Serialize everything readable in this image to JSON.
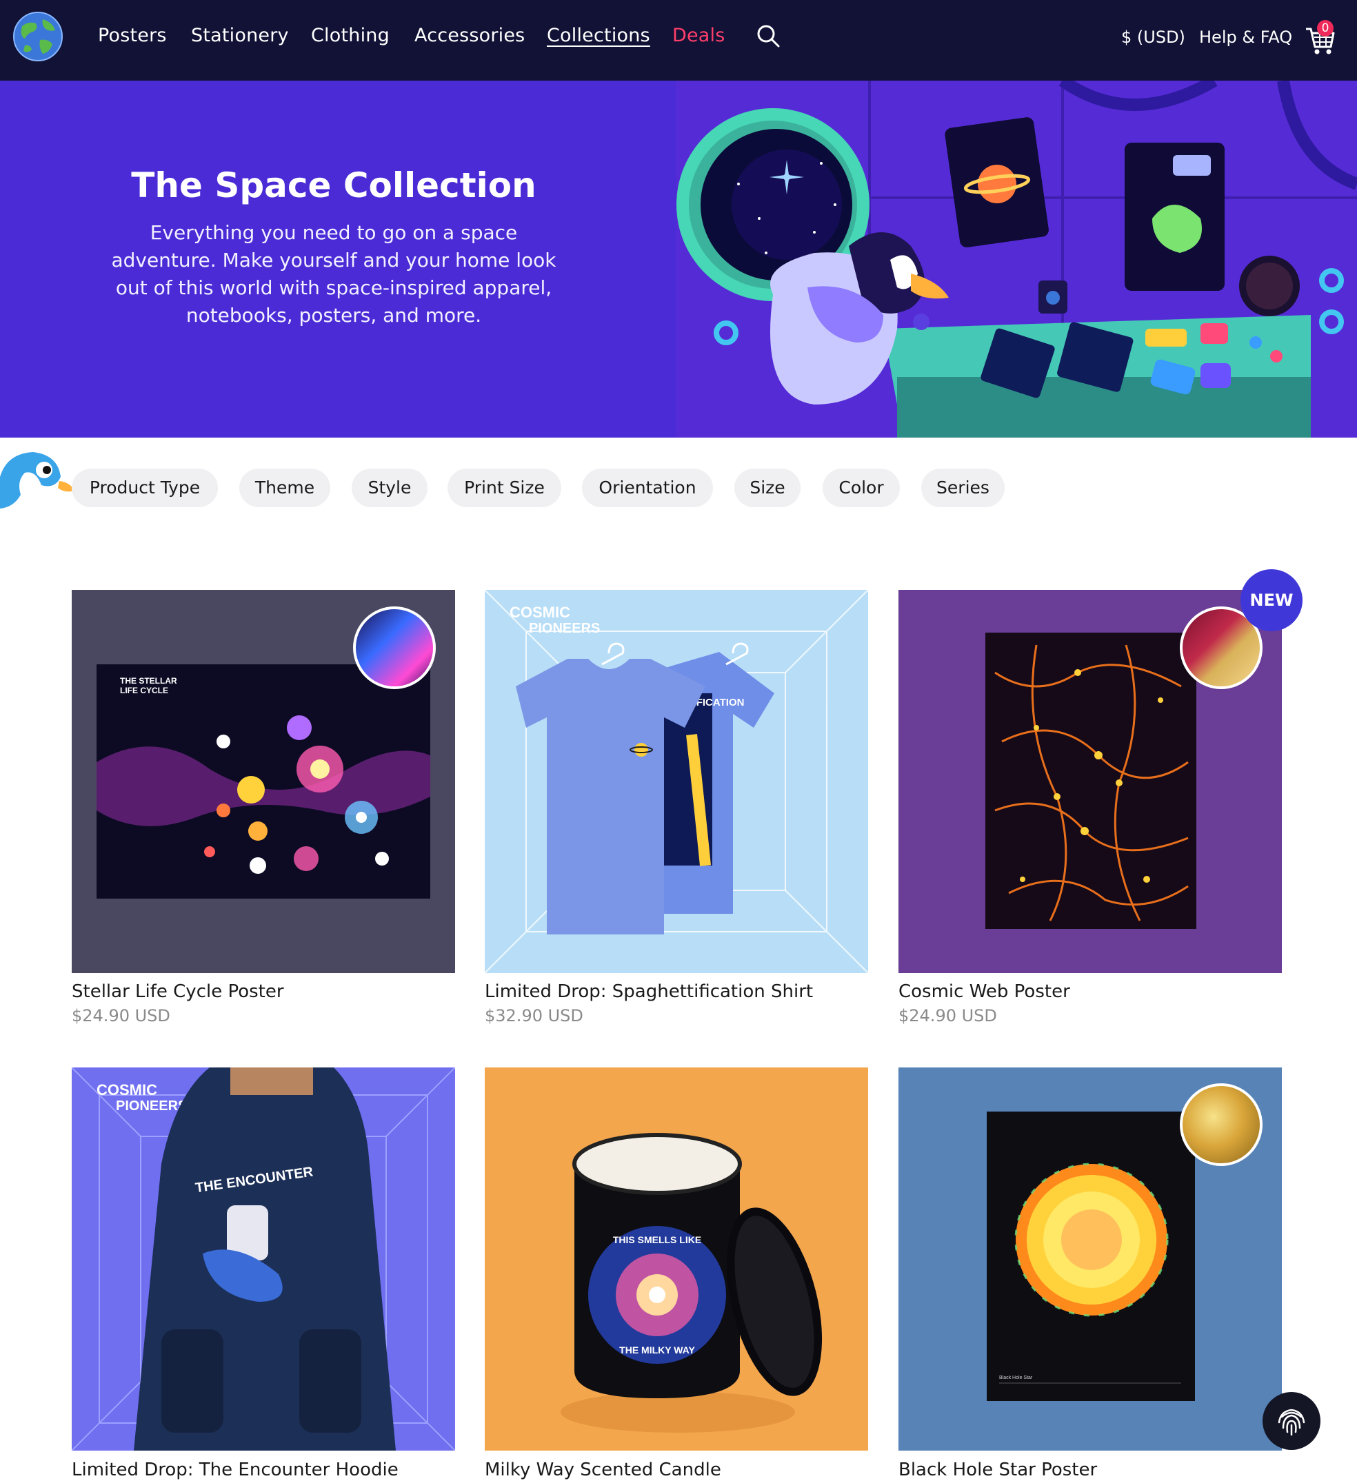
{
  "nav": {
    "links": [
      "Posters",
      "Stationery",
      "Clothing",
      "Accessories",
      "Collections",
      "Deals"
    ],
    "currency": "$ (USD)",
    "help": "Help & FAQ",
    "cart_count": "0"
  },
  "hero": {
    "title": "The Space Collection",
    "description": "Everything you need to go on a space adventure. Make yourself and your home look out of this world with space-inspired apparel, notebooks, posters, and more."
  },
  "filters": [
    "Product Type",
    "Theme",
    "Style",
    "Print Size",
    "Orientation",
    "Size",
    "Color",
    "Series"
  ],
  "products": [
    {
      "title": "Stellar Life Cycle Poster",
      "price": "$24.90 USD",
      "image_text": [
        "THE STELLAR",
        "LIFE CYCLE"
      ]
    },
    {
      "title": "Limited Drop: Spaghettification Shirt",
      "price": "$32.90 USD",
      "image_text": [
        "COSMIC",
        "PIONEERS",
        "SPAGHETTIFICATION"
      ]
    },
    {
      "title": "Cosmic Web Poster",
      "price": "$24.90 USD",
      "badge": "NEW"
    },
    {
      "title": "Limited Drop: The Encounter Hoodie",
      "image_text": [
        "COSMIC",
        "PIONEERS",
        "THE ENCOUNTER"
      ]
    },
    {
      "title": "Milky Way Scented Candle",
      "image_text": [
        "THIS SMELLS LIKE",
        "THE MILKY WAY"
      ]
    },
    {
      "title": "Black Hole Star Poster",
      "image_text": [
        "Black Hole Star"
      ]
    }
  ],
  "colors": {
    "nav_bg": "#111235",
    "hero_bg": "#4a2bd6",
    "deals": "#ff3f6c",
    "badge": "#4037d8",
    "chip_bg": "#f0f0f2",
    "price": "#8a8a8a"
  }
}
